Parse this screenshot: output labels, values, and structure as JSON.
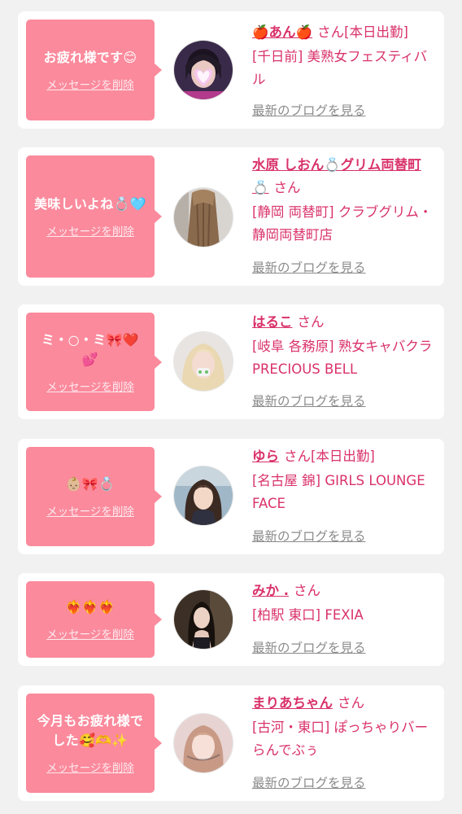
{
  "entries": [
    {
      "message": "お疲れ様です😊",
      "delete_label": "メッセージを削除",
      "name": "🍎あん🍎",
      "san": "さん",
      "status": "[本日出勤]",
      "shop": "[千日前] 美熟女フェスティバル",
      "blog_label": "最新のブログを見る"
    },
    {
      "message": "美味しいよね💍🩵",
      "delete_label": "メッセージを削除",
      "name": "水原 しおん💍グリム両替町💍",
      "san": "さん",
      "status": "",
      "shop": "[静岡 両替町] クラブグリム・静岡両替町店",
      "blog_label": "最新のブログを見る"
    },
    {
      "message": "ミ・○・ミ🎀❤️💕",
      "delete_label": "メッセージを削除",
      "name": "はるこ",
      "san": "さん",
      "status": "",
      "shop": "[岐阜 各務原] 熟女キャバクラ PRECIOUS BELL",
      "blog_label": "最新のブログを見る"
    },
    {
      "message": "👶🏼🎀💍",
      "delete_label": "メッセージを削除",
      "name": "ゆら",
      "san": "さん",
      "status": "[本日出勤]",
      "shop": "[名古屋 錦] GIRLS LOUNGE FACE",
      "blog_label": "最新のブログを見る"
    },
    {
      "message": "❤️‍🔥❤️‍🔥❤️‍🔥",
      "delete_label": "メッセージを削除",
      "name": "みか .",
      "san": "さん",
      "status": "",
      "shop": "[柏駅 東口] FEXIA",
      "blog_label": "最新のブログを見る"
    },
    {
      "message": "今月もお疲れ様でした🥰🫶✨",
      "delete_label": "メッセージを削除",
      "name": "まりあちゃん",
      "san": "さん",
      "status": "",
      "shop": "[古河・東口] ぽっちゃりバー らんでぶぅ",
      "blog_label": "最新のブログを見る"
    }
  ],
  "colors": {
    "bubble": "#fb8a9c",
    "accent_pink": "#d9326a",
    "link_gray": "#8b8b8b",
    "background": "#f1f1f1"
  }
}
